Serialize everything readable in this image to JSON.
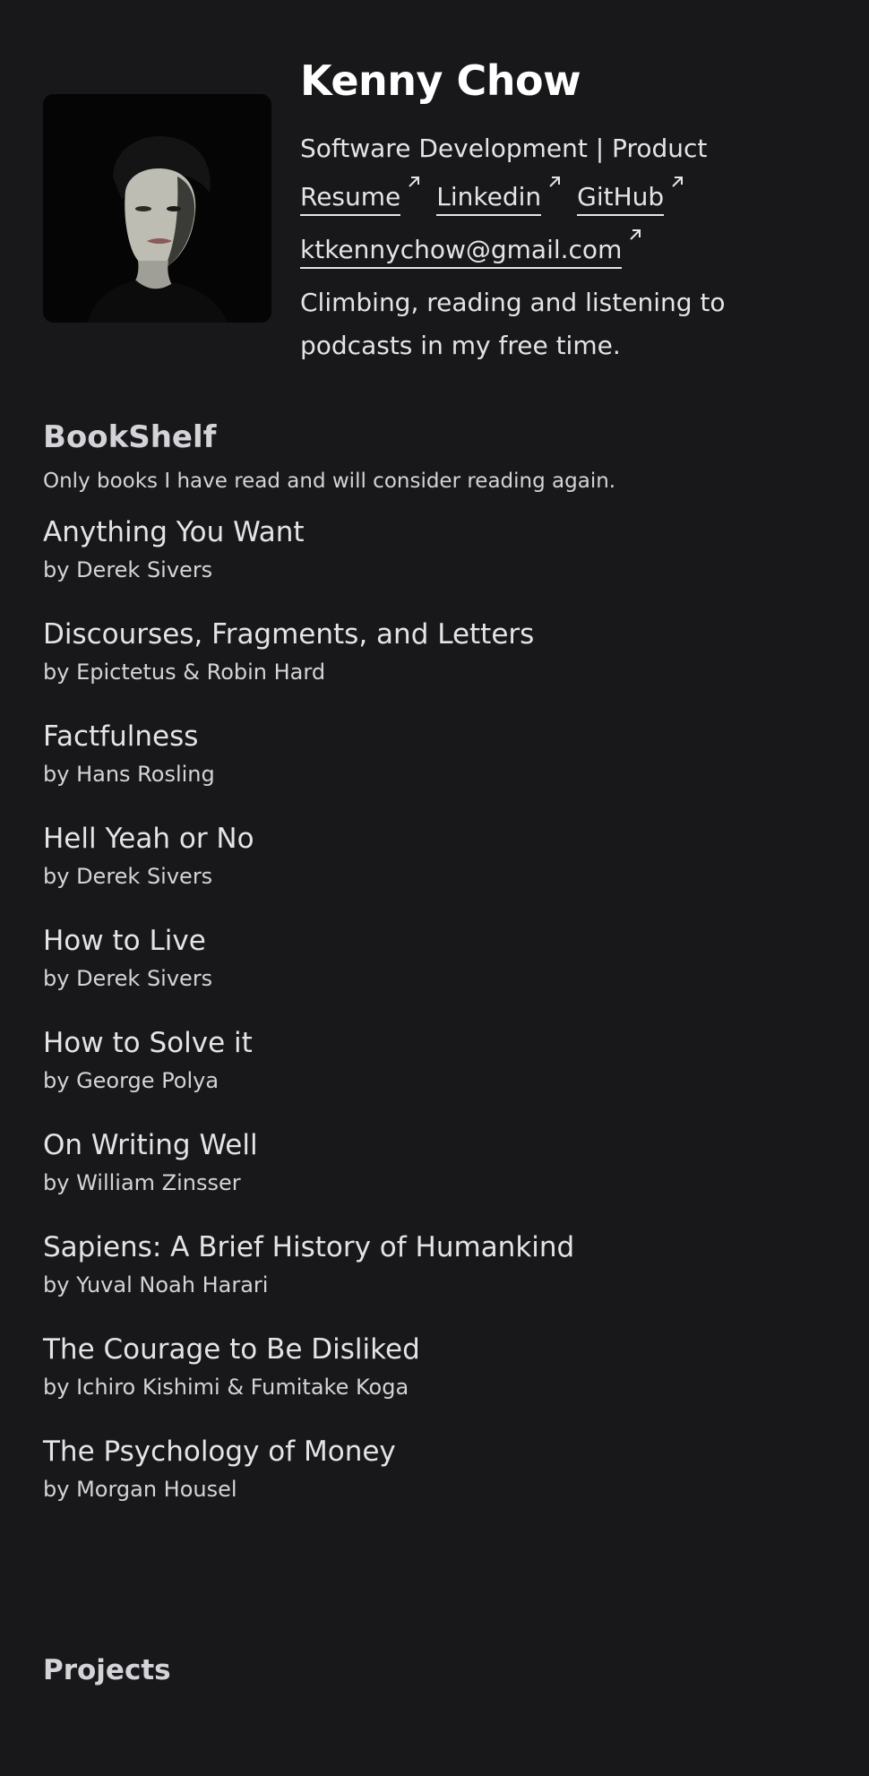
{
  "profile": {
    "name": "Kenny Chow",
    "role": "Software Development | Product",
    "links": [
      {
        "label": "Resume"
      },
      {
        "label": "Linkedin"
      },
      {
        "label": "GitHub"
      }
    ],
    "email": "ktkennychow@gmail.com",
    "bio": "Climbing, reading and listening to podcasts in my free time."
  },
  "bookshelf": {
    "title": "BookShelf",
    "subtitle": "Only books I have read and will consider reading again.",
    "books": [
      {
        "title": "Anything You Want",
        "author": "by Derek Sivers"
      },
      {
        "title": "Discourses, Fragments, and Letters",
        "author": "by Epictetus & Robin Hard"
      },
      {
        "title": "Factfulness",
        "author": "by Hans Rosling"
      },
      {
        "title": "Hell Yeah or No",
        "author": "by Derek Sivers"
      },
      {
        "title": "How to Live",
        "author": "by Derek Sivers"
      },
      {
        "title": "How to Solve it",
        "author": "by George Polya"
      },
      {
        "title": "On Writing Well",
        "author": "by William Zinsser"
      },
      {
        "title": "Sapiens: A Brief History of Humankind",
        "author": "by Yuval Noah Harari"
      },
      {
        "title": "The Courage to Be Disliked",
        "author": "by Ichiro Kishimi & Fumitake Koga"
      },
      {
        "title": "The Psychology of Money",
        "author": "by Morgan Housel"
      }
    ]
  },
  "projects": {
    "title": "Projects"
  },
  "icons": {
    "link_arrow": "arrow-up-right-icon"
  },
  "colors": {
    "background": "#18181b",
    "text": "#e4e4e7",
    "heading": "#ffffff"
  }
}
